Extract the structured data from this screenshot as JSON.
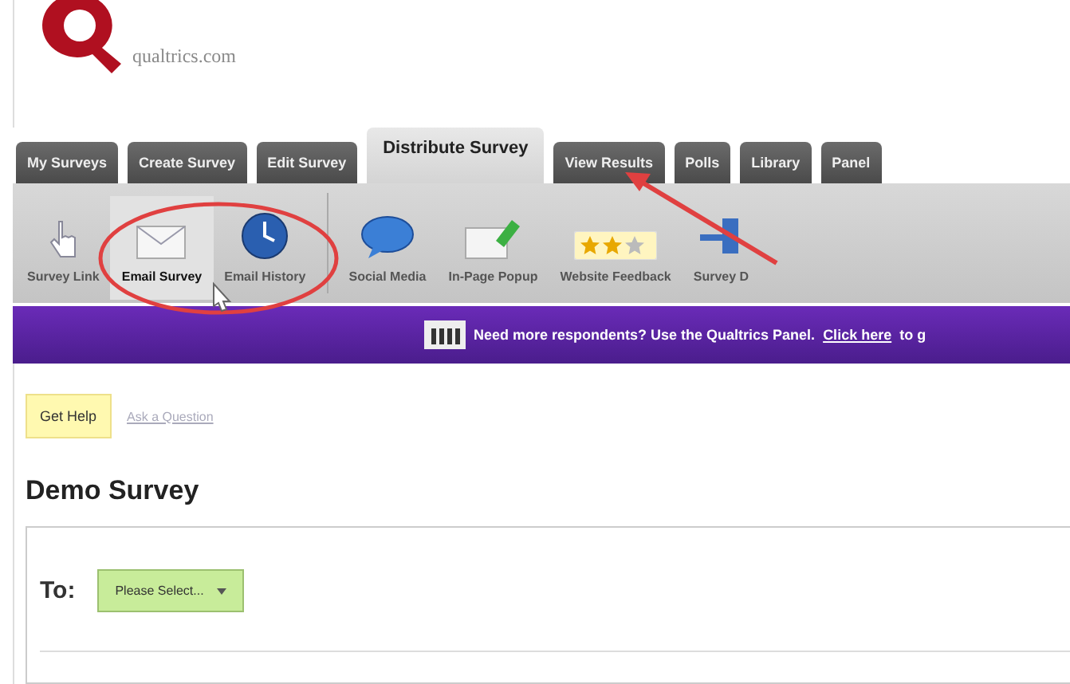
{
  "logo": {
    "text": "qualtrics.com"
  },
  "tabs": [
    {
      "label": "My Surveys",
      "selected": false
    },
    {
      "label": "Create Survey",
      "selected": false
    },
    {
      "label": "Edit Survey",
      "selected": false
    },
    {
      "label": "Distribute Survey",
      "selected": true
    },
    {
      "label": "View Results",
      "selected": false
    },
    {
      "label": "Polls",
      "selected": false
    },
    {
      "label": "Library",
      "selected": false
    },
    {
      "label": "Panel",
      "selected": false
    }
  ],
  "toolbar": [
    {
      "label": "Survey Link",
      "kind": "hand",
      "selected": false
    },
    {
      "label": "Email Survey",
      "kind": "envelope",
      "selected": true
    },
    {
      "label": "Email History",
      "kind": "clock",
      "selected": false
    },
    {
      "label": "Social Media",
      "kind": "bubble",
      "selected": false
    },
    {
      "label": "In-Page Popup",
      "kind": "popup",
      "selected": false
    },
    {
      "label": "Website Feedback",
      "kind": "stars",
      "selected": false
    },
    {
      "label": "Survey D",
      "kind": "network",
      "selected": false
    }
  ],
  "banner": {
    "text": "Need more respondents? Use the Qualtrics Panel.",
    "link": "Click here",
    "tail": "to g"
  },
  "help": {
    "button": "Get Help",
    "link": "Ask a Question"
  },
  "title": "Demo Survey",
  "to_field": {
    "label": "To:",
    "value": "Please Select..."
  }
}
